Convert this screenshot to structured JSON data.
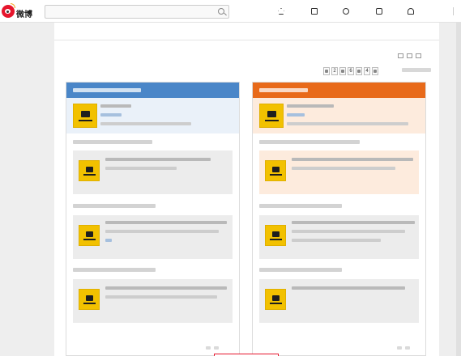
{
  "brand": {
    "logo": "weibo-logo"
  },
  "search": {
    "placeholder": ""
  },
  "nav": {
    "items": [
      {
        "label": "",
        "icon": "home-icon"
      },
      {
        "label": "",
        "icon": "video-icon"
      },
      {
        "label": "",
        "icon": "discover-icon"
      },
      {
        "label": "",
        "icon": "game-icon"
      },
      {
        "label": "",
        "icon": "user-icon"
      }
    ]
  },
  "tabs": [
    {
      "label": ""
    },
    {
      "label": "",
      "active": true
    }
  ],
  "page": {
    "title": ""
  },
  "columns": {
    "left": {
      "header": "",
      "accent": "#4a86c8"
    },
    "right": {
      "header": "",
      "accent": "#e86a1a"
    }
  },
  "pager": {
    "pages": [
      "2",
      "6",
      "4"
    ]
  },
  "colors": {
    "brand_red": "#e6162d",
    "orange": "#fa7d3c",
    "blue": "#4a86c8"
  }
}
